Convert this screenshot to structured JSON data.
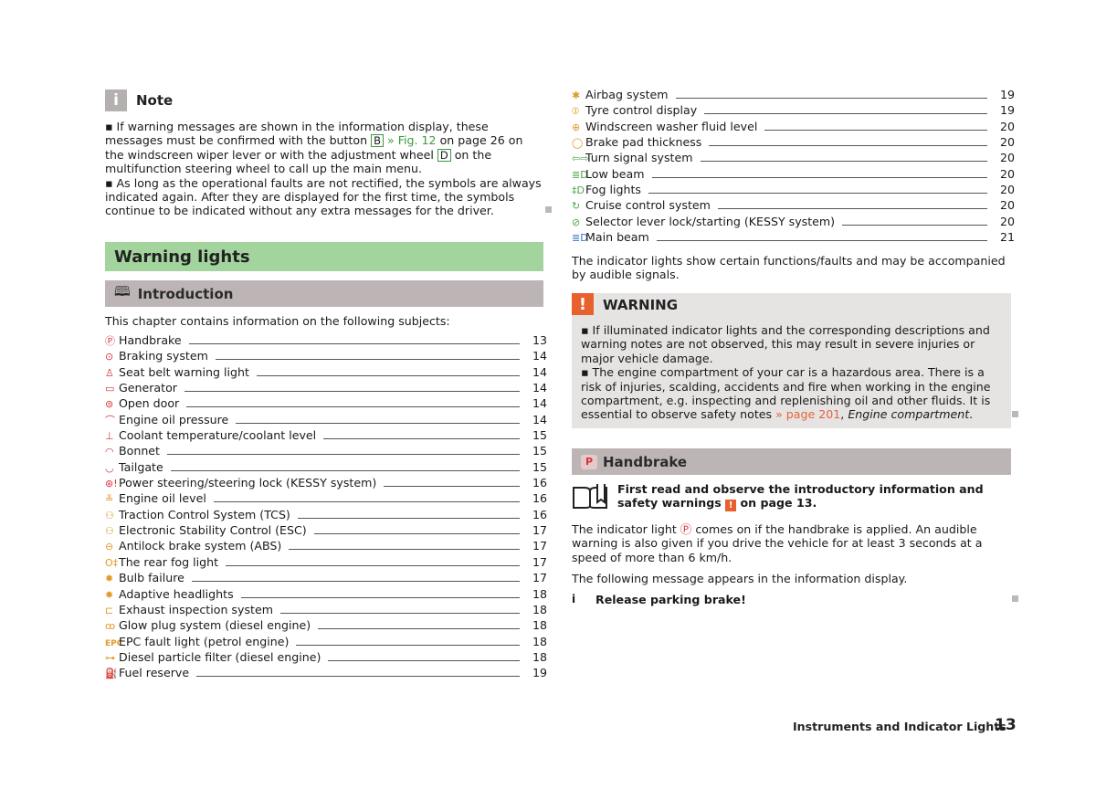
{
  "note": {
    "badge": "i",
    "title": "Note",
    "p1_a": "▪ If warning messages are shown in the information display, these messages must be confirmed with the button ",
    "p1_btn_b": "B",
    "p1_link": " » Fig. 12",
    "p1_b": " on page 26 on the windscreen wiper lever or with the adjustment wheel ",
    "p1_btn_d": "D",
    "p1_c": " on the multifunction steering wheel to call up the main menu.",
    "p2": "▪ As long as the operational faults are not rectified, the symbols are always indicated again. After they are displayed for the first time, the symbols continue to be indicated without any extra messages for the driver."
  },
  "section_title": "Warning lights",
  "intro": {
    "icon": "book-icon",
    "title": "Introduction",
    "lead_text": "This chapter contains information on the following subjects:"
  },
  "toc_left": [
    {
      "icon": "Ⓟ",
      "color": "red",
      "label": "Handbrake",
      "page": "13"
    },
    {
      "icon": "⊙",
      "color": "red",
      "label": "Braking system",
      "page": "14"
    },
    {
      "icon": "♙",
      "color": "red",
      "label": "Seat belt warning light",
      "page": "14"
    },
    {
      "icon": "▭",
      "color": "red",
      "label": "Generator",
      "page": "14"
    },
    {
      "icon": "⊜",
      "color": "red",
      "label": "Open door",
      "page": "14"
    },
    {
      "icon": "⌒",
      "color": "red",
      "label": "Engine oil pressure",
      "page": "14"
    },
    {
      "icon": "⊥",
      "color": "red",
      "label": "Coolant temperature/coolant level",
      "page": "15"
    },
    {
      "icon": "◠",
      "color": "red",
      "label": "Bonnet",
      "page": "15"
    },
    {
      "icon": "◡",
      "color": "red",
      "label": "Tailgate",
      "page": "15"
    },
    {
      "icon": "⊛!",
      "color": "red",
      "label": "Power steering/steering lock (KESSY system)",
      "page": "16"
    },
    {
      "icon": "≚",
      "color": "amber",
      "label": "Engine oil level",
      "page": "16"
    },
    {
      "icon": "⚇",
      "color": "amber",
      "label": "Traction Control System (TCS)",
      "page": "16"
    },
    {
      "icon": "⚇",
      "color": "amber",
      "label": "Electronic Stability Control (ESC)",
      "page": "17"
    },
    {
      "icon": "⊖",
      "color": "amber",
      "label": "Antilock brake system (ABS)",
      "page": "17"
    },
    {
      "icon": "O‡",
      "color": "amber",
      "label": "The rear fog light",
      "page": "17"
    },
    {
      "icon": "✹",
      "color": "amber",
      "label": "Bulb failure",
      "page": "17"
    },
    {
      "icon": "✹",
      "color": "amber",
      "label": "Adaptive headlights",
      "page": "18"
    },
    {
      "icon": "⊏",
      "color": "amber",
      "label": "Exhaust inspection system",
      "page": "18"
    },
    {
      "icon": "ꝏ",
      "color": "amber",
      "label": "Glow plug system (diesel engine)",
      "page": "18"
    },
    {
      "icon": "EPC",
      "color": "amber",
      "label": "EPC fault light (petrol engine)",
      "page": "18"
    },
    {
      "icon": "⊶",
      "color": "amber",
      "label": "Diesel particle filter (diesel engine)",
      "page": "18"
    },
    {
      "icon": "⛽",
      "color": "amber",
      "label": "Fuel reserve",
      "page": "19"
    }
  ],
  "toc_right": [
    {
      "icon": "✱",
      "color": "amber",
      "label": "Airbag system",
      "page": "19"
    },
    {
      "icon": "⦶",
      "color": "amber",
      "label": "Tyre control display",
      "page": "19"
    },
    {
      "icon": "⊕",
      "color": "amber",
      "label": "Windscreen washer fluid level",
      "page": "20"
    },
    {
      "icon": "◯",
      "color": "amber",
      "label": "Brake pad thickness",
      "page": "20"
    },
    {
      "icon": "⇦⇨",
      "color": "grn",
      "label": "Turn signal system",
      "page": "20"
    },
    {
      "icon": "≣D",
      "color": "grn",
      "label": "Low beam",
      "page": "20"
    },
    {
      "icon": "‡D",
      "color": "grn",
      "label": "Fog lights",
      "page": "20"
    },
    {
      "icon": "↻",
      "color": "grn",
      "label": "Cruise control system",
      "page": "20"
    },
    {
      "icon": "⊘",
      "color": "grn",
      "label": "Selector lever lock/starting (KESSY system)",
      "page": "20"
    },
    {
      "icon": "≣D",
      "color": "blu",
      "label": "Main beam",
      "page": "21"
    }
  ],
  "indicator_text": "The indicator lights show certain functions/faults and may be accompanied by audible signals.",
  "warning": {
    "badge": "!",
    "title": "WARNING",
    "p1": "▪ If illuminated indicator lights and the corresponding descriptions and warning notes are not observed, this may result in severe injuries or major vehicle damage.",
    "p2_a": "▪ The engine compartment of your car is a hazardous area. There is a risk of injuries, scalding, accidents and fire when working in the engine compartment, e.g. inspecting and replenishing oil and other fluids. It is essential to observe safety notes ",
    "p2_link": "» page 201",
    "p2_b": ", ",
    "p2_ref": "Engine compartment",
    "p2_c": "."
  },
  "handbrake": {
    "icon": "P",
    "title": "Handbrake",
    "first_read_a": "First read and observe the introductory information and safety warnings ",
    "first_read_badge": "!",
    "first_read_b": " on page 13.",
    "p1_a": "The indicator light ",
    "p1_icon": "Ⓟ",
    "p1_b": " comes on if the handbrake is applied. An audible warning is also given if you drive the vehicle for at least 3 seconds at a speed of more than 6 km/h.",
    "p2": "The following message appears in the information display.",
    "message_icon": "i",
    "message": "Release parking brake!"
  },
  "footer": {
    "chapter": "Instruments and Indicator Lights",
    "page": "13"
  },
  "colors": {
    "green_header": "#a3d49e",
    "grey_header": "#bdb5b5",
    "warning_orange": "#e8602d",
    "link_green": "#3c9b3c",
    "warning_bg": "#e6e4e2"
  }
}
